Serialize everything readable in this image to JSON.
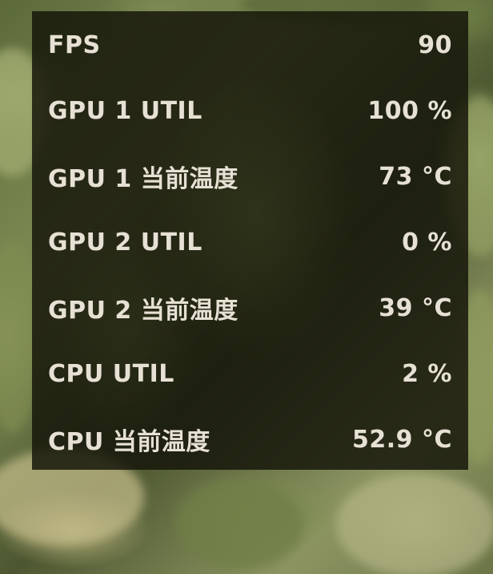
{
  "overlay": {
    "rows": [
      {
        "label": "FPS",
        "value": "90"
      },
      {
        "label": "GPU 1 UTIL",
        "value": "100 %"
      },
      {
        "label": "GPU 1 当前温度",
        "value": "73 °C"
      },
      {
        "label": "GPU 2 UTIL",
        "value": "0 %"
      },
      {
        "label": "GPU 2 当前温度",
        "value": "39 °C"
      },
      {
        "label": "CPU UTIL",
        "value": "2 %"
      },
      {
        "label": "CPU 当前温度",
        "value": "52.9 °C"
      }
    ]
  },
  "colors": {
    "panel_background": "#16160a",
    "text": "#e6e1d4"
  }
}
